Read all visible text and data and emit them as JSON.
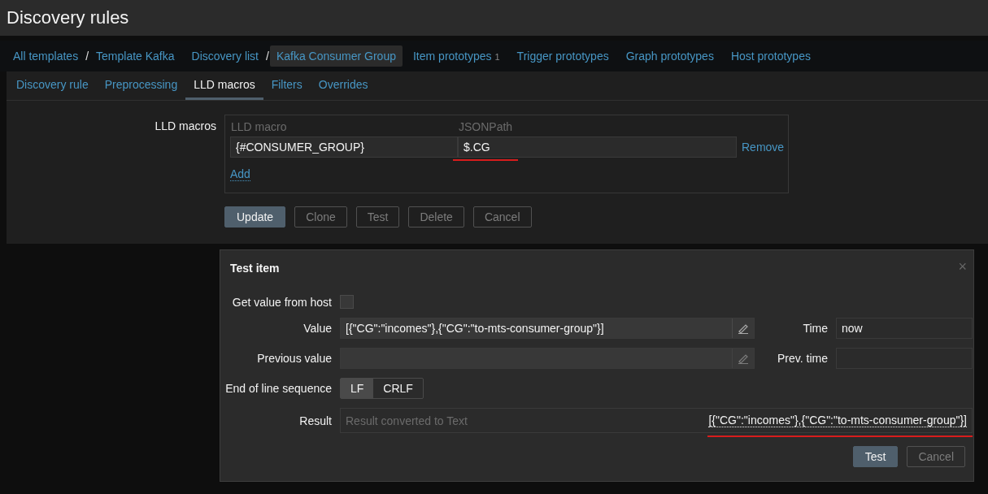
{
  "page_title": "Discovery rules",
  "breadcrumbs": [
    {
      "label": "All templates",
      "separator": "/",
      "selected": false
    },
    {
      "label": "Template Kafka",
      "selected": false
    },
    {
      "label": "Discovery list",
      "separator": "/",
      "selected": false
    },
    {
      "label": "Kafka Consumer Group",
      "selected": true
    },
    {
      "label": "Item prototypes",
      "count": "1",
      "selected": false
    },
    {
      "label": "Trigger prototypes",
      "selected": false
    },
    {
      "label": "Graph prototypes",
      "selected": false
    },
    {
      "label": "Host prototypes",
      "selected": false
    }
  ],
  "tabs": [
    {
      "label": "Discovery rule",
      "selected": false
    },
    {
      "label": "Preprocessing",
      "selected": false
    },
    {
      "label": "LLD macros",
      "selected": true
    },
    {
      "label": "Filters",
      "selected": false
    },
    {
      "label": "Overrides",
      "selected": false
    }
  ],
  "lld_macros": {
    "label": "LLD macros",
    "columns": [
      "LLD macro",
      "JSONPath"
    ],
    "rows": [
      {
        "macro": "{#CONSUMER_GROUP}",
        "path": "$.CG",
        "remove": "Remove"
      }
    ],
    "add": "Add"
  },
  "form_buttons": [
    {
      "label": "Update",
      "primary": true
    },
    {
      "label": "Clone",
      "primary": false
    },
    {
      "label": "Test",
      "primary": false
    },
    {
      "label": "Delete",
      "primary": false
    },
    {
      "label": "Cancel",
      "primary": false
    }
  ],
  "dialog": {
    "title": "Test item",
    "close": "×",
    "get_value_label": "Get value from host",
    "get_value_checked": false,
    "value_label": "Value",
    "value": "[{\"CG\":\"incomes\"},{\"CG\":\"to-mts-consumer-group\"}]",
    "time_label": "Time",
    "time": "now",
    "prev_value_label": "Previous value",
    "prev_time_label": "Prev. time",
    "eol_label": "End of line sequence",
    "eol_options": [
      {
        "label": "LF",
        "selected": true
      },
      {
        "label": "CRLF",
        "selected": false
      }
    ],
    "result_label": "Result",
    "result_placeholder": "Result converted to Text",
    "result": "[{\"CG\":\"incomes\"},{\"CG\":\"to-mts-consumer-group\"}]",
    "buttons": [
      {
        "label": "Test",
        "primary": true
      },
      {
        "label": "Cancel",
        "primary": false
      }
    ]
  }
}
